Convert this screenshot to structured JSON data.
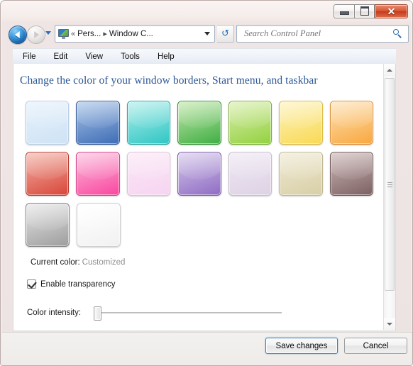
{
  "window": {
    "controls": {
      "minimize_label": "Minimize",
      "maximize_label": "Maximize",
      "close_label": "✕"
    }
  },
  "navigation": {
    "back_label": "Back",
    "forward_label": "Forward",
    "recent_pages_label": "Recent pages",
    "refresh_glyph": "↺",
    "refresh_label": "Refresh",
    "breadcrumb": {
      "overflow": "«",
      "items": [
        "Pers...",
        "Window C..."
      ],
      "separator": "▸",
      "dropdown_label": "Previous locations"
    },
    "icon": "personalization-monitor-icon"
  },
  "search": {
    "placeholder": "Search Control Panel",
    "value": "",
    "icon": "search-icon"
  },
  "menubar": {
    "items": [
      {
        "label": "File"
      },
      {
        "label": "Edit"
      },
      {
        "label": "View"
      },
      {
        "label": "Tools"
      },
      {
        "label": "Help"
      }
    ]
  },
  "main": {
    "title": "Change the color of your window borders, Start menu, and taskbar",
    "swatches": [
      [
        {
          "name": "sky",
          "top": "#e4f0fb",
          "bottom": "#cfe3f5",
          "edge": "#b9cfe4"
        },
        {
          "name": "blue",
          "top": "#a9c4e8",
          "bottom": "#3d6cb5",
          "edge": "#2f5796"
        },
        {
          "name": "teal",
          "top": "#aeeeea",
          "bottom": "#2fc6c4",
          "edge": "#26a8a6"
        },
        {
          "name": "green",
          "top": "#c3e8ac",
          "bottom": "#3fae43",
          "edge": "#359339"
        },
        {
          "name": "lime",
          "top": "#d9eeae",
          "bottom": "#93d13f",
          "edge": "#7cb334"
        },
        {
          "name": "yellow",
          "top": "#fdf3bd",
          "bottom": "#f9d954",
          "edge": "#ddbd46"
        },
        {
          "name": "orange",
          "top": "#fde2b5",
          "bottom": "#f9a73e",
          "edge": "#dd9034"
        }
      ],
      [
        {
          "name": "red",
          "top": "#f3b3a6",
          "bottom": "#d8463a",
          "edge": "#ba3a30"
        },
        {
          "name": "pink",
          "top": "#fbbedd",
          "bottom": "#f9469f",
          "edge": "#d93a87"
        },
        {
          "name": "rose",
          "top": "#fbe7f6",
          "bottom": "#f6d4f1",
          "edge": "#ddc0d8"
        },
        {
          "name": "violet",
          "top": "#d6c9ea",
          "bottom": "#8f6cc4",
          "edge": "#7a5bab"
        },
        {
          "name": "lavender",
          "top": "#eee7f2",
          "bottom": "#ded2e5",
          "edge": "#c7bccd"
        },
        {
          "name": "khaki",
          "top": "#efe9d2",
          "bottom": "#d8cfa7",
          "edge": "#bfb792"
        },
        {
          "name": "taupe",
          "top": "#cdb8b8",
          "bottom": "#7d6162",
          "edge": "#6b5353"
        }
      ],
      [
        {
          "name": "graphite",
          "top": "#e6e6e6",
          "bottom": "#9d9d9d",
          "edge": "#888888"
        },
        {
          "name": "white",
          "top": "#ffffff",
          "bottom": "#f1f1f1",
          "edge": "#cfcfcf"
        }
      ]
    ],
    "current_color_label": "Current color:",
    "current_color_value": "Customized",
    "transparency_label": "Enable transparency",
    "transparency_checked": true,
    "intensity_label": "Color intensity:",
    "intensity_value": 0
  },
  "footer": {
    "save_label": "Save changes",
    "cancel_label": "Cancel"
  }
}
